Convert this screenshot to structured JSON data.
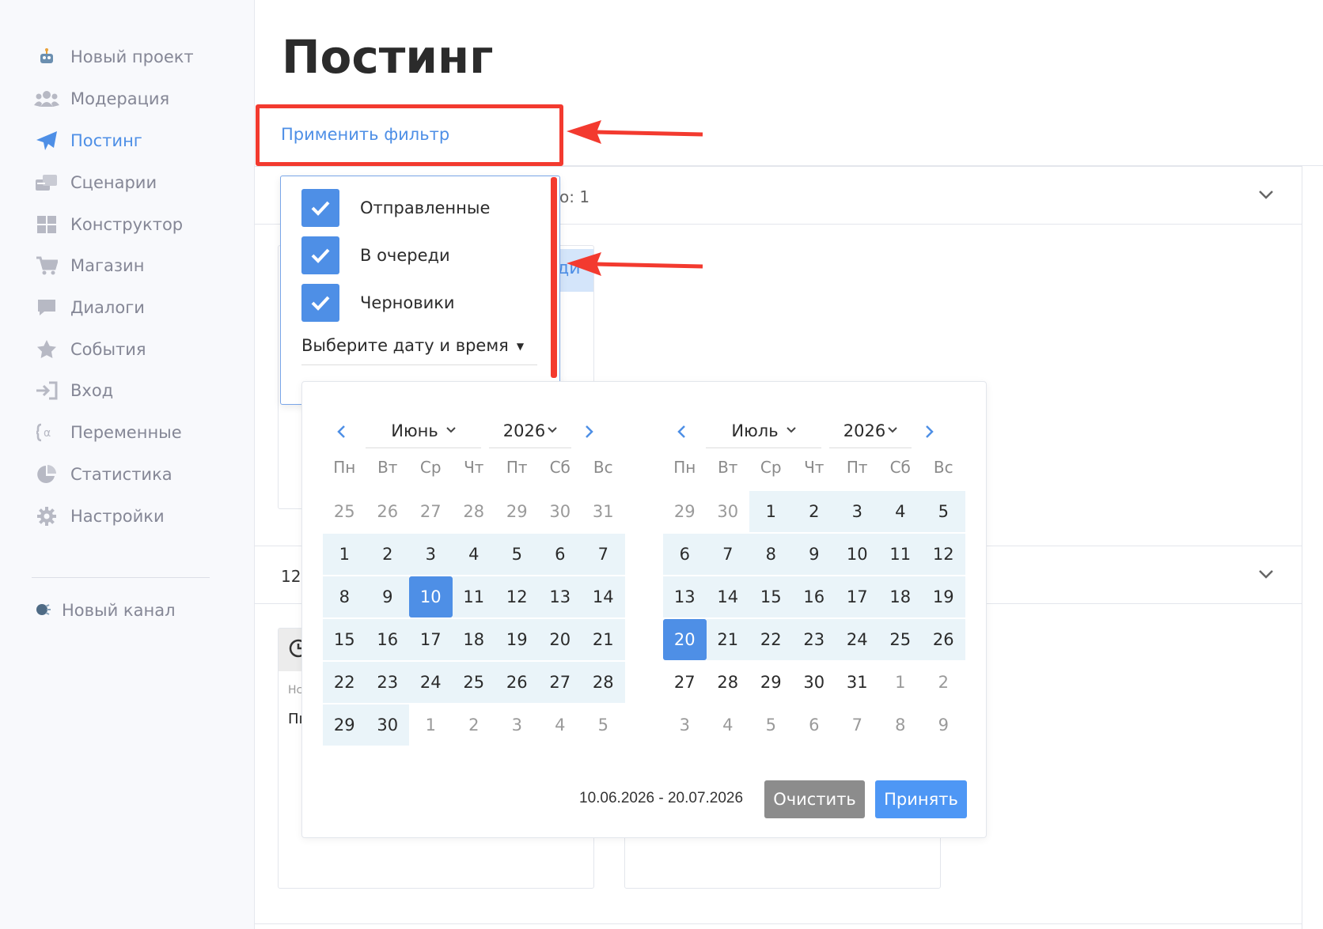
{
  "sidebar": {
    "items": [
      {
        "label": "Новый проект",
        "icon": "robot-icon"
      },
      {
        "label": "Модерация",
        "icon": "users-icon"
      },
      {
        "label": "Постинг",
        "icon": "paper-plane-icon",
        "active": true
      },
      {
        "label": "Сценарии",
        "icon": "scenarios-icon"
      },
      {
        "label": "Конструктор",
        "icon": "grid-icon"
      },
      {
        "label": "Магазин",
        "icon": "cart-icon"
      },
      {
        "label": "Диалоги",
        "icon": "comment-icon"
      },
      {
        "label": "События",
        "icon": "star-icon"
      },
      {
        "label": "Вход",
        "icon": "sign-in-icon"
      },
      {
        "label": "Переменные",
        "icon": "variable-icon"
      },
      {
        "label": "Статистика",
        "icon": "pie-chart-icon"
      },
      {
        "label": "Настройки",
        "icon": "gear-icon"
      }
    ],
    "new_channel": "Новый канал"
  },
  "main": {
    "title": "Постинг",
    "apply_filter": "Применить фильтр",
    "accordion1_text": "о: 1",
    "accordion2_text": "12",
    "card_text1": "Нс",
    "card_text2": "Пı",
    "card_partial": "ди"
  },
  "filter": {
    "checkboxes": [
      {
        "label": "Отправленные",
        "checked": true
      },
      {
        "label": "В очереди",
        "checked": true
      },
      {
        "label": "Черновики",
        "checked": true
      }
    ],
    "date_select": "Выберите дату и время"
  },
  "calendar": {
    "weekdays": [
      "Пн",
      "Вт",
      "Ср",
      "Чт",
      "Пт",
      "Сб",
      "Вс"
    ],
    "left": {
      "month": "Июнь",
      "year": "2026",
      "days": [
        [
          "25",
          "26",
          "27",
          "28",
          "29",
          "30",
          "31"
        ],
        [
          "1",
          "2",
          "3",
          "4",
          "5",
          "6",
          "7"
        ],
        [
          "8",
          "9",
          "10",
          "11",
          "12",
          "13",
          "14"
        ],
        [
          "15",
          "16",
          "17",
          "18",
          "19",
          "20",
          "21"
        ],
        [
          "22",
          "23",
          "24",
          "25",
          "26",
          "27",
          "28"
        ],
        [
          "29",
          "30",
          "1",
          "2",
          "3",
          "4",
          "5"
        ]
      ]
    },
    "right": {
      "month": "Июль",
      "year": "2026",
      "days": [
        [
          "29",
          "30",
          "1",
          "2",
          "3",
          "4",
          "5"
        ],
        [
          "6",
          "7",
          "8",
          "9",
          "10",
          "11",
          "12"
        ],
        [
          "13",
          "14",
          "15",
          "16",
          "17",
          "18",
          "19"
        ],
        [
          "20",
          "21",
          "22",
          "23",
          "24",
          "25",
          "26"
        ],
        [
          "27",
          "28",
          "29",
          "30",
          "31",
          "1",
          "2"
        ],
        [
          "3",
          "4",
          "5",
          "6",
          "7",
          "8",
          "9"
        ]
      ]
    },
    "range_text": "10.06.2026 - 20.07.2026",
    "clear_label": "Очистить",
    "accept_label": "Принять"
  },
  "colors": {
    "accent": "#4e8fe6",
    "highlight": "#f33a2f",
    "range_bg": "#eaf4f9",
    "clear_btn": "#8c8c8c"
  }
}
